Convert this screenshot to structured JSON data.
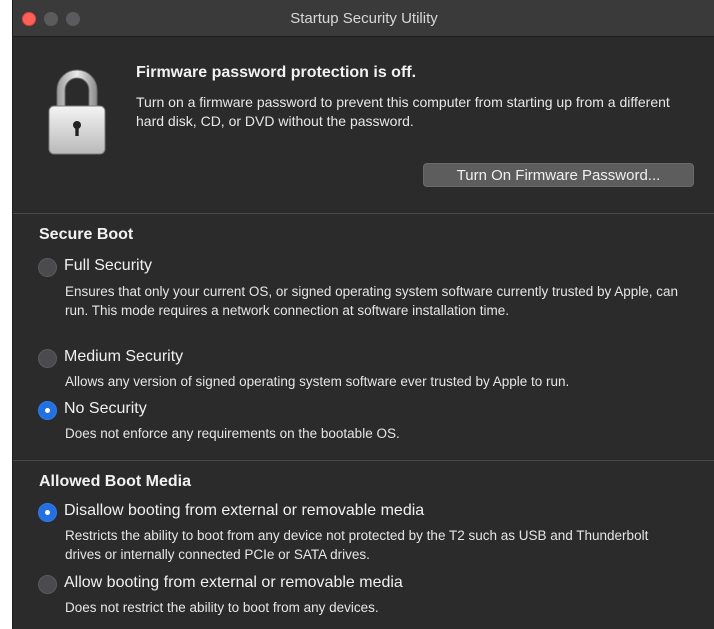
{
  "window": {
    "title": "Startup Security Utility"
  },
  "firmware": {
    "status_title": "Firmware password protection is off.",
    "description": "Turn on a firmware password to prevent this computer from starting up from a different hard disk, CD, or DVD without the password.",
    "button_label": "Turn On Firmware Password..."
  },
  "secure_boot": {
    "title": "Secure Boot",
    "options": [
      {
        "label": "Full Security",
        "description": "Ensures that only your current OS, or signed operating system software currently trusted by Apple, can run. This mode requires a network connection at software installation time.",
        "selected": false
      },
      {
        "label": "Medium Security",
        "description": "Allows any version of signed operating system software ever trusted by Apple to run.",
        "selected": false
      },
      {
        "label": "No Security",
        "description": "Does not enforce any requirements on the bootable OS.",
        "selected": true
      }
    ]
  },
  "boot_media": {
    "title": "Allowed Boot Media",
    "options": [
      {
        "label": "Disallow booting from external or removable media",
        "description": "Restricts the ability to boot from any device not protected by the T2 such as USB and Thunderbolt drives or internally connected PCIe or SATA drives.",
        "selected": true
      },
      {
        "label": "Allow booting from external or removable media",
        "description": "Does not restrict the ability to boot from any devices.",
        "selected": false
      }
    ]
  },
  "colors": {
    "window_bg": "#2b2b2c",
    "accent": "#2470e0",
    "close_button": "#ff5f57"
  }
}
